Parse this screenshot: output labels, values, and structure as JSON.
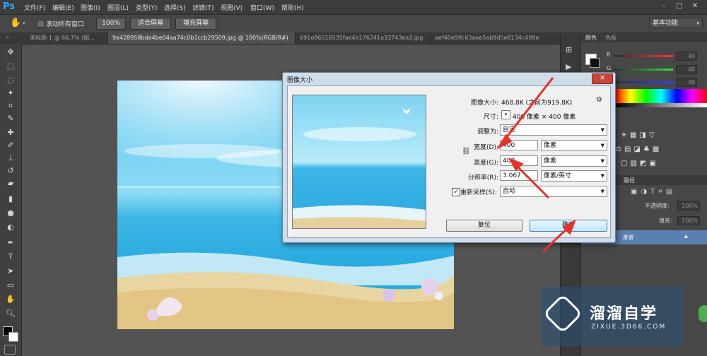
{
  "app": {
    "logo": "Ps"
  },
  "menu": [
    "文件(F)",
    "编辑(E)",
    "图像(I)",
    "图层(L)",
    "类型(Y)",
    "选择(S)",
    "滤镜(T)",
    "视图(V)",
    "窗口(W)",
    "帮助(H)"
  ],
  "options": {
    "scroll_all_label": "滚动所有窗口",
    "scroll_all_checked": false,
    "btn_100": "100%",
    "btn_fit": "适合屏幕",
    "btn_fill": "填充屏幕",
    "workspace": "基本功能"
  },
  "tabs": [
    {
      "label": "未标题-1 @ 66.7% (图…",
      "active": false
    },
    {
      "label": "9e428958bde4be04aa74c0b1ccb29509.jpg @ 100%(RGB/8#)",
      "active": true
    },
    {
      "label": "691e86516535fae4a176241a33743ea3.jpg",
      "active": false
    },
    {
      "label": "aef40e99c63aae5ab9d5e8134c499e",
      "active": false
    }
  ],
  "panel": {
    "color_tab": "颜色",
    "swatch_tab": "色板",
    "r_label": "R",
    "g_label": "G",
    "b_label": "B",
    "r_value": "49",
    "g_value": "48",
    "b_value": "48",
    "paths_tab": "路径",
    "opacity_label": "不透明度:",
    "opacity_value": "100%",
    "fill_label": "填充:",
    "fill_value": "100%",
    "layer_name": "背景"
  },
  "dialog": {
    "title": "图像大小",
    "image_size_label": "图像大小:",
    "image_size_value": "468.8K (之前为919.8K)",
    "dimension_label": "尺寸:",
    "dimension_value": "400 像素 × 400 像素",
    "fit_label": "调整为:",
    "fit_value": "自定",
    "width_label": "宽度(D):",
    "width_value": "400",
    "width_unit": "像素",
    "height_label": "高度(G):",
    "height_value": "400",
    "height_unit": "像素",
    "resolution_label": "分辨率(R):",
    "resolution_value": "3.067",
    "resolution_unit": "像素/英寸",
    "resample_label": "重新采样(S):",
    "resample_checked": true,
    "resample_value": "自动",
    "reset_button": "复位",
    "ok_button": "确定"
  },
  "watermark": {
    "name": "溜溜自学",
    "url": "ZIXUE.3D66.COM"
  },
  "colors": {
    "accent": "#31a8ff",
    "arrow": "#e0342c"
  }
}
